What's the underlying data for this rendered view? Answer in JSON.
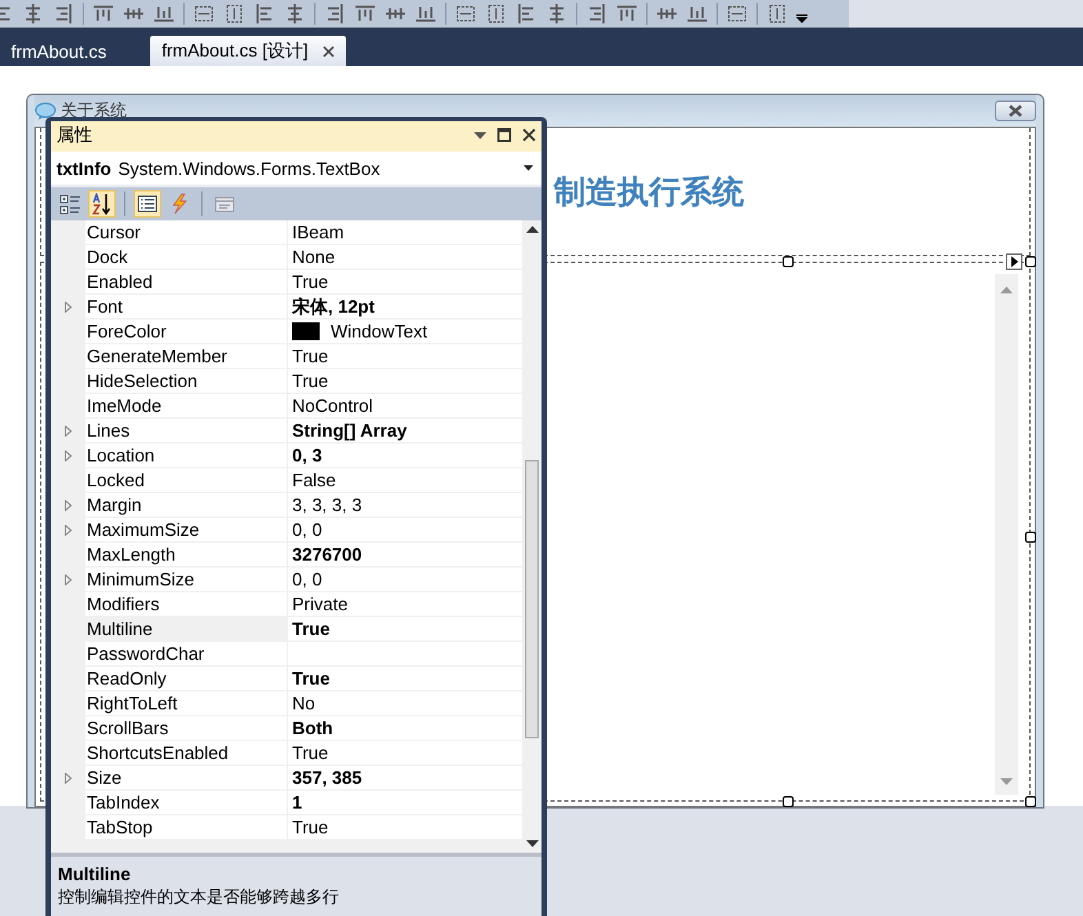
{
  "document_tabs": [
    {
      "label": "frmAbout.cs",
      "selected": false
    },
    {
      "label": "frmAbout.cs [设计]",
      "selected": true
    }
  ],
  "form": {
    "title": "关于系统",
    "heading": "制造执行系统"
  },
  "properties": {
    "title": "属性",
    "object_name": "txtInfo",
    "object_type": "System.Windows.Forms.TextBox",
    "toolbar": [
      {
        "kind": "categorized",
        "selected": false
      },
      {
        "kind": "alphabetical",
        "selected": true
      },
      {
        "kind": "properties",
        "selected": true
      },
      {
        "kind": "events",
        "selected": false
      },
      {
        "kind": "pages",
        "selected": false
      }
    ],
    "rows": [
      {
        "name": "Cursor",
        "value": "IBeam",
        "bold": false,
        "expandable": false,
        "selected": false
      },
      {
        "name": "Dock",
        "value": "None",
        "bold": false,
        "expandable": false,
        "selected": false
      },
      {
        "name": "Enabled",
        "value": "True",
        "bold": false,
        "expandable": false,
        "selected": false
      },
      {
        "name": "Font",
        "value": "宋体, 12pt",
        "bold": true,
        "expandable": true,
        "selected": false
      },
      {
        "name": "ForeColor",
        "value": "WindowText",
        "bold": false,
        "expandable": false,
        "selected": false,
        "color": "#000000"
      },
      {
        "name": "GenerateMember",
        "value": "True",
        "bold": false,
        "expandable": false,
        "selected": false
      },
      {
        "name": "HideSelection",
        "value": "True",
        "bold": false,
        "expandable": false,
        "selected": false
      },
      {
        "name": "ImeMode",
        "value": "NoControl",
        "bold": false,
        "expandable": false,
        "selected": false
      },
      {
        "name": "Lines",
        "value": "String[] Array",
        "bold": true,
        "expandable": true,
        "selected": false
      },
      {
        "name": "Location",
        "value": "0, 3",
        "bold": true,
        "expandable": true,
        "selected": false
      },
      {
        "name": "Locked",
        "value": "False",
        "bold": false,
        "expandable": false,
        "selected": false
      },
      {
        "name": "Margin",
        "value": "3, 3, 3, 3",
        "bold": false,
        "expandable": true,
        "selected": false
      },
      {
        "name": "MaximumSize",
        "value": "0, 0",
        "bold": false,
        "expandable": true,
        "selected": false
      },
      {
        "name": "MaxLength",
        "value": "3276700",
        "bold": true,
        "expandable": false,
        "selected": false
      },
      {
        "name": "MinimumSize",
        "value": "0, 0",
        "bold": false,
        "expandable": true,
        "selected": false
      },
      {
        "name": "Modifiers",
        "value": "Private",
        "bold": false,
        "expandable": false,
        "selected": false
      },
      {
        "name": "Multiline",
        "value": "True",
        "bold": true,
        "expandable": false,
        "selected": true
      },
      {
        "name": "PasswordChar",
        "expandable": false,
        "selected": false
      },
      {
        "name": "ReadOnly",
        "value": "True",
        "bold": true,
        "expandable": false,
        "selected": false
      },
      {
        "name": "RightToLeft",
        "value": "No",
        "bold": false,
        "expandable": false,
        "selected": false
      },
      {
        "name": "ScrollBars",
        "value": "Both",
        "bold": true,
        "expandable": false,
        "selected": false
      },
      {
        "name": "ShortcutsEnabled",
        "value": "True",
        "bold": false,
        "expandable": false,
        "selected": false
      },
      {
        "name": "Size",
        "value": "357, 385",
        "bold": true,
        "expandable": true,
        "selected": false
      },
      {
        "name": "TabIndex",
        "value": "1",
        "bold": true,
        "expandable": false,
        "selected": false
      },
      {
        "name": "TabStop",
        "value": "True",
        "bold": false,
        "expandable": false,
        "selected": false
      }
    ],
    "description": {
      "title": "Multiline",
      "text": "控制编辑控件的文本是否能够跨越多行"
    }
  }
}
